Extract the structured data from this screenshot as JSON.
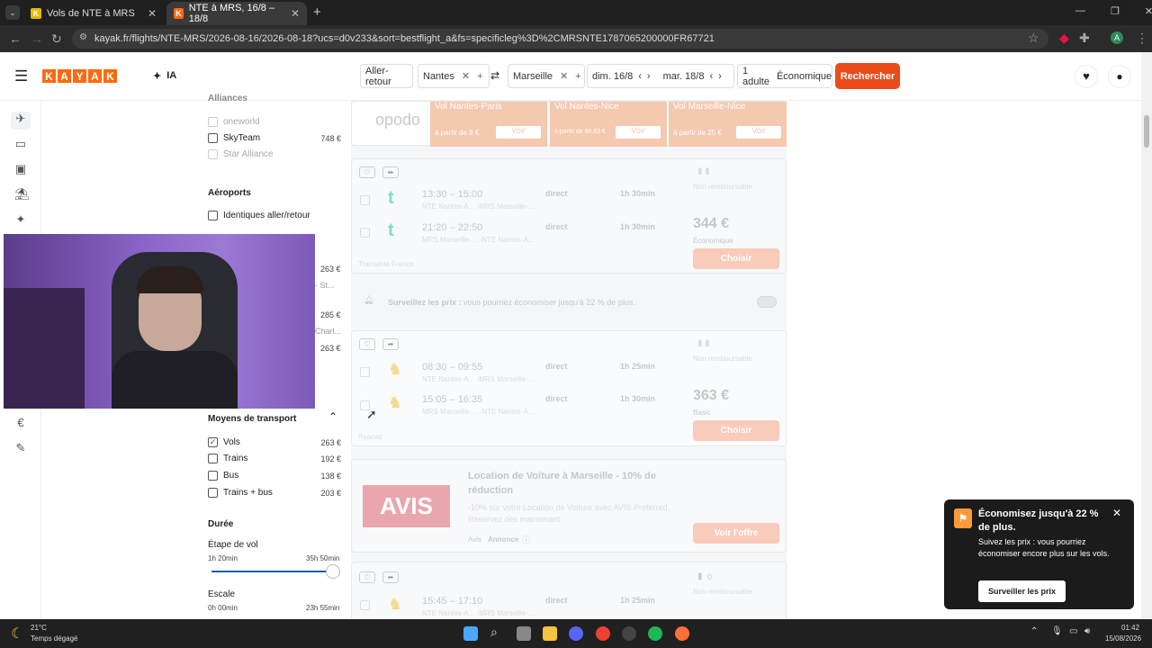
{
  "tabs": [
    {
      "label": "Vols de NTE à MRS",
      "close": "✕"
    },
    {
      "label": "NTE à MRS, 16/8 – 18/8",
      "close": "✕"
    }
  ],
  "new_tab": "+",
  "url": "kayak.fr/flights/NTE-MRS/2026-08-16/2026-08-18?ucs=d0v233&sort=bestflight_a&fs=specificleg%3D%2CMRSNTE1787065200000FR67721",
  "header": {
    "logo": [
      "K",
      "A",
      "Y",
      "A",
      "K"
    ],
    "ai_label": "IA",
    "trip_type": "Aller-retour",
    "origin": "Nantes",
    "destination": "Marseille",
    "depart_date": "dim. 16/8",
    "return_date": "mar. 18/8",
    "passengers": "1 adulte",
    "cabin": "Économique",
    "search_label": "Rechercher"
  },
  "filters": {
    "alliance_title": "Alliances",
    "alliances": [
      {
        "label": "oneworld",
        "price": "",
        "disabled": true
      },
      {
        "label": "SkyTeam",
        "price": "748 €",
        "disabled": false
      },
      {
        "label": "Star Alliance",
        "price": "",
        "disabled": true
      }
    ],
    "airports_title": "Aéroports",
    "same_airport": "Identiques aller/retour",
    "hidden_prices": [
      "263 €",
      "285 €",
      "263 €"
    ],
    "hidden_text": [
      "- St...",
      "Charl..."
    ],
    "transport_title": "Moyens de transport",
    "transport": [
      {
        "label": "Vols",
        "price": "263 €",
        "checked": true
      },
      {
        "label": "Trains",
        "price": "192 €",
        "checked": false
      },
      {
        "label": "Bus",
        "price": "138 €",
        "checked": false
      },
      {
        "label": "Trains + bus",
        "price": "203 €",
        "checked": false
      }
    ],
    "duration_title": "Durée",
    "leg_label": "Étape de vol",
    "leg_min": "1h 20min",
    "leg_max": "35h 50min",
    "stopover_label": "Escale",
    "stop_min": "0h 00min",
    "stop_max": "23h 55min"
  },
  "ads": {
    "brand": "opodo",
    "offers": [
      {
        "title": "Vol Nantes-Paris",
        "price": "à partir de 8 €",
        "btn": "Voir"
      },
      {
        "title": "Vol Nantes-Nice",
        "price": "à partir de 60,63 €",
        "btn": "Voir"
      },
      {
        "title": "Vol Marseille-Nice",
        "price": "à partir de 25 €",
        "btn": "Voir"
      }
    ]
  },
  "results": [
    {
      "legs": [
        {
          "times": "13:30 – 15:00",
          "route": "NTE Nantes-A... -MRS Marseille-...",
          "stops": "direct",
          "duration": "1h 30min"
        },
        {
          "times": "21:20 – 22:50",
          "route": "MRS Marseille-... -NTE Nantes-A...",
          "stops": "direct",
          "duration": "1h 30min"
        }
      ],
      "airline": "Transavia France",
      "refund": "Non remboursable",
      "price": "344 €",
      "fare": "Économique",
      "cta": "Choisir"
    },
    {
      "legs": [
        {
          "times": "08:30 – 09:55",
          "route": "NTE Nantes-A... -MRS Marseille-...",
          "stops": "direct",
          "duration": "1h 25min"
        },
        {
          "times": "15:05 – 16:35",
          "route": "MRS Marseille-... -NTE Nantes-A...",
          "stops": "direct",
          "duration": "1h 30min"
        }
      ],
      "airline": "Ryanair",
      "refund": "Non remboursable",
      "price": "363 €",
      "fare": "Basic",
      "cta": "Choisir"
    },
    {
      "legs": [
        {
          "times": "15:45 – 17:10",
          "route": "NTE Nantes-A... -MRS Marseille-...",
          "stops": "direct",
          "duration": "1h 25min"
        }
      ],
      "refund": "Non remboursable",
      "bag_count": "0"
    }
  ],
  "price_alert": {
    "label": "Surveillez les prix :",
    "text": "vous pourriez économiser jusqu'à 22 % de plus."
  },
  "avis": {
    "logo": "AVIS",
    "title": "Location de Voiture à Marseille - 10% de réduction",
    "desc": "-10% sur votre Location de Voiture avec AVIS Preferred. Réservez dès maintenant",
    "source": "Avis",
    "ad_label": "Annonce",
    "cta": "Voir l'offre"
  },
  "toast": {
    "title": "Économisez jusqu'à 22 % de plus.",
    "body": "Suivez les prix : vous pourriez économiser encore plus sur les vols.",
    "cta": "Surveiller les prix"
  },
  "taskbar": {
    "temp": "21°C",
    "weather": "Temps dégagé",
    "time": "01:42",
    "date": "15/08/2026"
  },
  "colors": {
    "kayak_orange": "#ff690f",
    "search_btn": "#e94b1b",
    "toast_bg": "#1b1b1b"
  }
}
